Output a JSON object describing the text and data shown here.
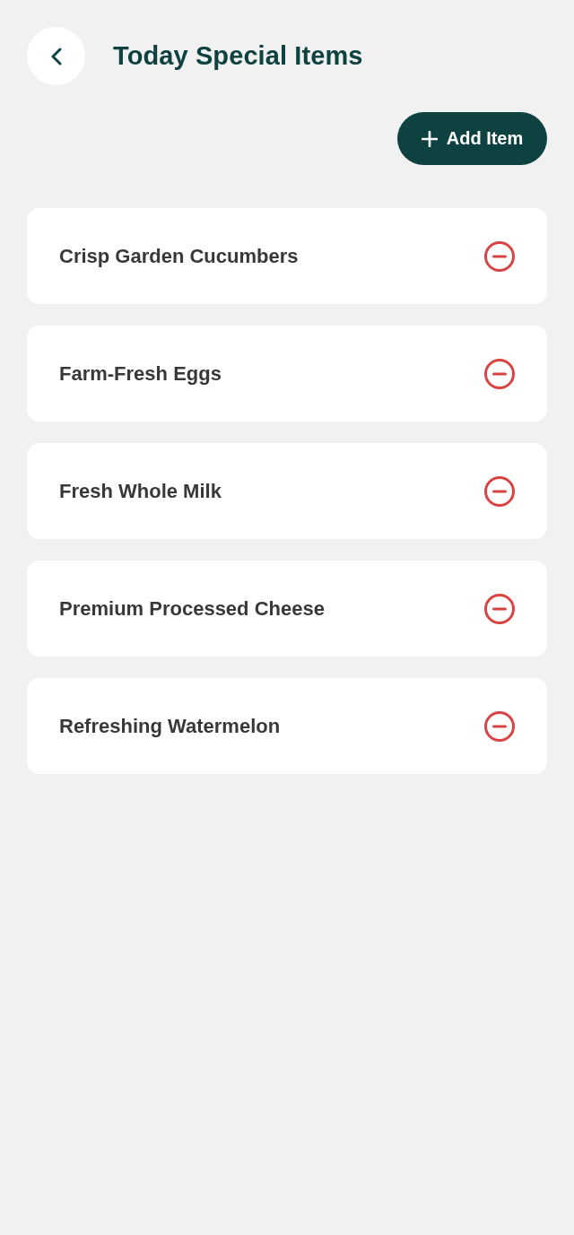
{
  "header": {
    "title": "Today Special Items"
  },
  "add_button": {
    "label": "Add Item"
  },
  "items": [
    {
      "name": "Crisp Garden Cucumbers"
    },
    {
      "name": "Farm-Fresh Eggs"
    },
    {
      "name": "Fresh Whole Milk"
    },
    {
      "name": "Premium Processed Cheese"
    },
    {
      "name": "Refreshing Watermelon"
    }
  ]
}
